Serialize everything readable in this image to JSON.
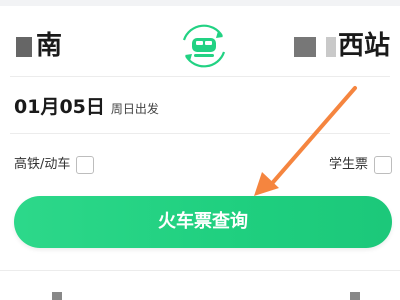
{
  "stations": {
    "from": "南",
    "to": "西站"
  },
  "trip": {
    "date": "01月05日",
    "weekday_note": "周日出发"
  },
  "options": {
    "highspeed_label": "高铁/动车",
    "student_label": "学生票"
  },
  "search_button_label": "火车票查询",
  "colors": {
    "accent": "#22d283",
    "arrow": "#f5853f"
  },
  "icons": {
    "swap": "train-swap-icon"
  }
}
